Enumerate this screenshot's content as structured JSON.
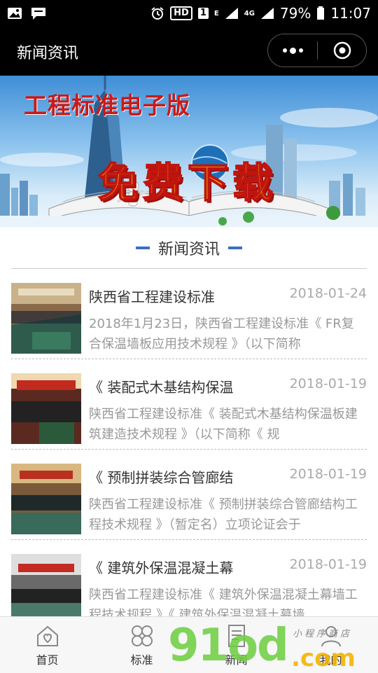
{
  "status_bar": {
    "hd": "HD",
    "sim": "1",
    "network_e": "E",
    "network_4g": "4G",
    "battery": "79%",
    "time": "11:07"
  },
  "nav": {
    "title": "新闻资讯"
  },
  "banner": {
    "title": "工程标准电子版",
    "cta": "免费下载"
  },
  "section": {
    "title": "新闻资讯"
  },
  "news": [
    {
      "headline": "陕西省工程建设标准",
      "date": "2018-01-24",
      "summary": "2018年1月23日，陕西省工程建设标准《 FR复合保温墙板应用技术规程 》（以下简称"
    },
    {
      "headline": "《 装配式木基结构保温",
      "date": "2018-01-19",
      "summary": "陕西省工程建设标准《 装配式木基结构保温板建筑建造技术规程 》（以下简称《 规"
    },
    {
      "headline": "《 预制拼装综合管廊结",
      "date": "2018-01-19",
      "summary": "陕西省工程建设标准《 预制拼装综合管廊结构工程技术规程 》（暂定名）立项论证会于"
    },
    {
      "headline": "《 建筑外保温混凝土幕",
      "date": "2018-01-19",
      "summary": "陕西省工程建设标准《 建筑外保温混凝土幕墙工程技术规程 》《 建筑外保温混凝土幕墙"
    }
  ],
  "tabs": [
    {
      "label": "首页",
      "icon": "home-icon"
    },
    {
      "label": "标准",
      "icon": "grid-icon"
    },
    {
      "label": "新闻",
      "icon": "news-icon"
    },
    {
      "label": "我的",
      "icon": "user-icon"
    }
  ],
  "watermark": {
    "main": "91od",
    "com": ".com",
    "sub": "小程序商店"
  },
  "colors": {
    "accent": "#3d6fc3",
    "bar_bg": "#000000",
    "banner_red": "#c81a1a",
    "banner_yellow": "#ffd200"
  }
}
